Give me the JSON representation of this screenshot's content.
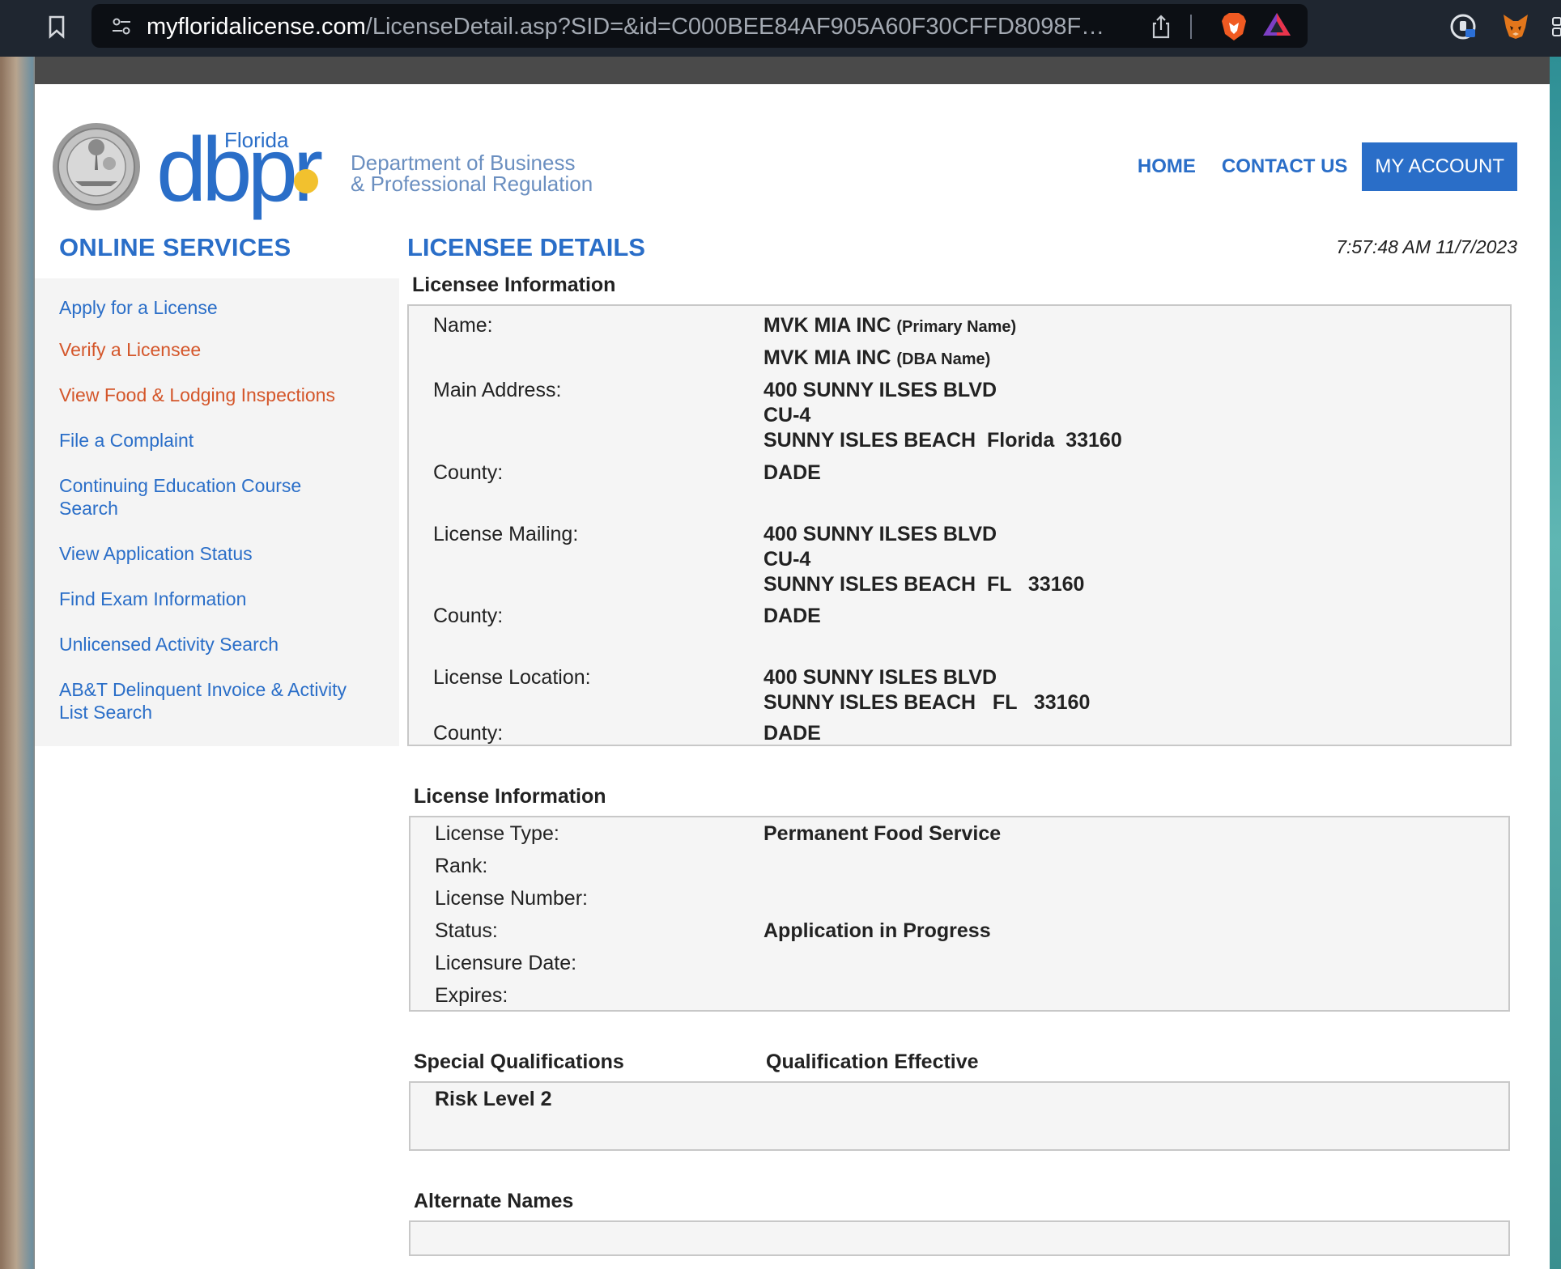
{
  "browser": {
    "url_host": "myfloridalicense.com",
    "url_path": "/LicenseDetail.asp?SID=&id=C000BEE84AF905A60F30CFFD8098F…"
  },
  "header": {
    "logo_state": "Florida",
    "logo_word": "dbpr",
    "logo_line1": "Department of Business",
    "logo_line2": "& Professional Regulation",
    "nav": {
      "home": "HOME",
      "contact": "CONTACT US",
      "account": "MY ACCOUNT"
    }
  },
  "sidebar": {
    "title": "ONLINE SERVICES",
    "items": [
      {
        "label": "Apply for a License"
      },
      {
        "label": "Verify a Licensee"
      },
      {
        "label": "View Food & Lodging Inspections"
      },
      {
        "label": "File a Complaint"
      },
      {
        "label": "Continuing Education Course"
      },
      {
        "label": "Search"
      },
      {
        "label": "View Application Status"
      },
      {
        "label": "Find Exam Information"
      },
      {
        "label": "Unlicensed Activity Search"
      },
      {
        "label": "AB&T Delinquent Invoice & Activity"
      },
      {
        "label": "List Search"
      }
    ]
  },
  "main": {
    "title": "LICENSEE DETAILS",
    "timestamp": "7:57:48 AM 11/7/2023",
    "licensee": {
      "heading": "Licensee Information",
      "name_label": "Name:",
      "primary_name": "MVK MIA INC",
      "primary_tag": "(Primary Name)",
      "dba_name": "MVK MIA INC",
      "dba_tag": "(DBA Name)",
      "main_address_label": "Main Address:",
      "main_address_1": "400 SUNNY ILSES BLVD",
      "main_address_2": "CU-4",
      "main_address_3": "SUNNY ISLES BEACH  Florida  33160",
      "county_label": "County:",
      "county_1": "DADE",
      "mailing_label": "License Mailing:",
      "mailing_1": "400 SUNNY ILSES BLVD",
      "mailing_2": "CU-4",
      "mailing_3": "SUNNY ISLES BEACH  FL   33160",
      "county_2": "DADE",
      "location_label": "License Location:",
      "location_1": "400 SUNNY ISLES BLVD",
      "location_2": "SUNNY ISLES BEACH   FL   33160",
      "county_3": "DADE"
    },
    "license": {
      "heading": "License Information",
      "type_label": "License Type:",
      "type_value": "Permanent Food Service",
      "rank_label": "Rank:",
      "number_label": "License Number:",
      "status_label": "Status:",
      "status_value": "Application in Progress",
      "date_label": "Licensure Date:",
      "expires_label": "Expires:"
    },
    "qualifications": {
      "heading": "Special Qualifications",
      "effective_heading": "Qualification Effective",
      "item": "Risk Level 2"
    },
    "alternate": {
      "heading": "Alternate Names"
    }
  }
}
